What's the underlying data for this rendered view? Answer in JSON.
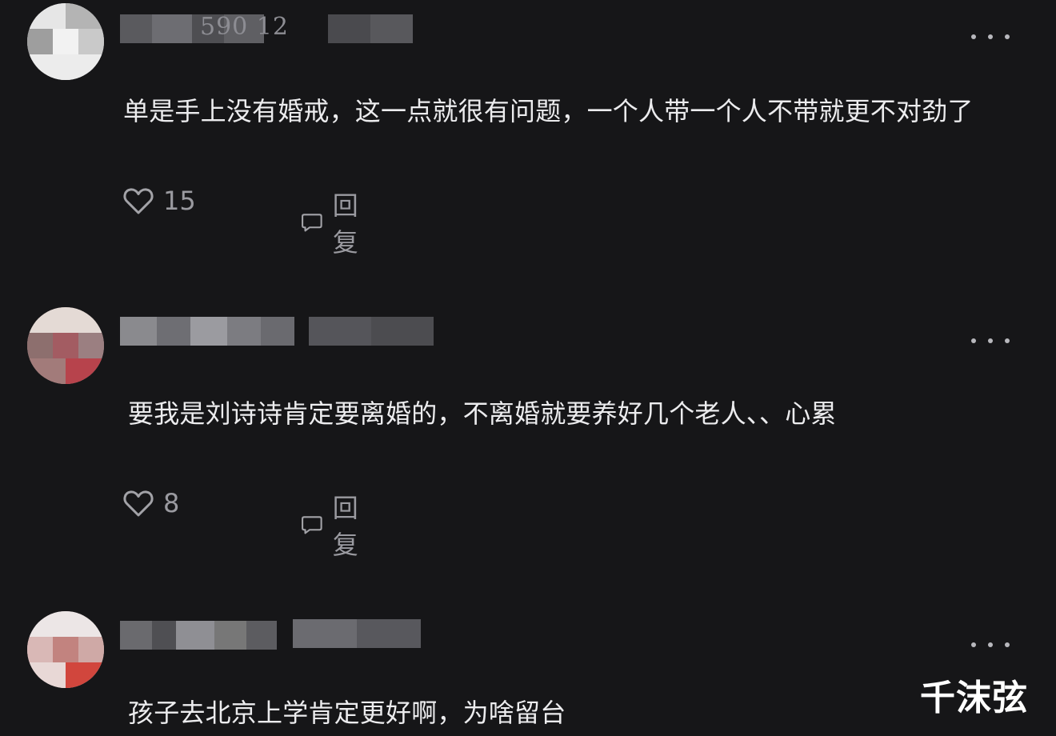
{
  "colors": {
    "background": "#161618",
    "text_primary": "#ececee",
    "text_secondary": "#9a9aa0",
    "icon": "#a3a3a8"
  },
  "comments": [
    {
      "meta_visible": "590  12",
      "text": "单是手上没有婚戒，这一点就很有问题，一个人带一个人不带就更不对劲了",
      "likes": "15",
      "reply_label": "回复",
      "like_icon": "heart-outline-icon",
      "reply_icon": "comment-bubble-icon",
      "more_icon": "more-dots-icon"
    },
    {
      "text": "要我是刘诗诗肯定要离婚的，不离婚就要养好几个老人、、心累",
      "likes": "8",
      "reply_label": "回复",
      "like_icon": "heart-outline-icon",
      "reply_icon": "comment-bubble-icon",
      "more_icon": "more-dots-icon"
    },
    {
      "text": "孩子去北京上学肯定更好啊，为啥留台",
      "more_icon": "more-dots-icon"
    }
  ],
  "watermark": "千沫弦"
}
